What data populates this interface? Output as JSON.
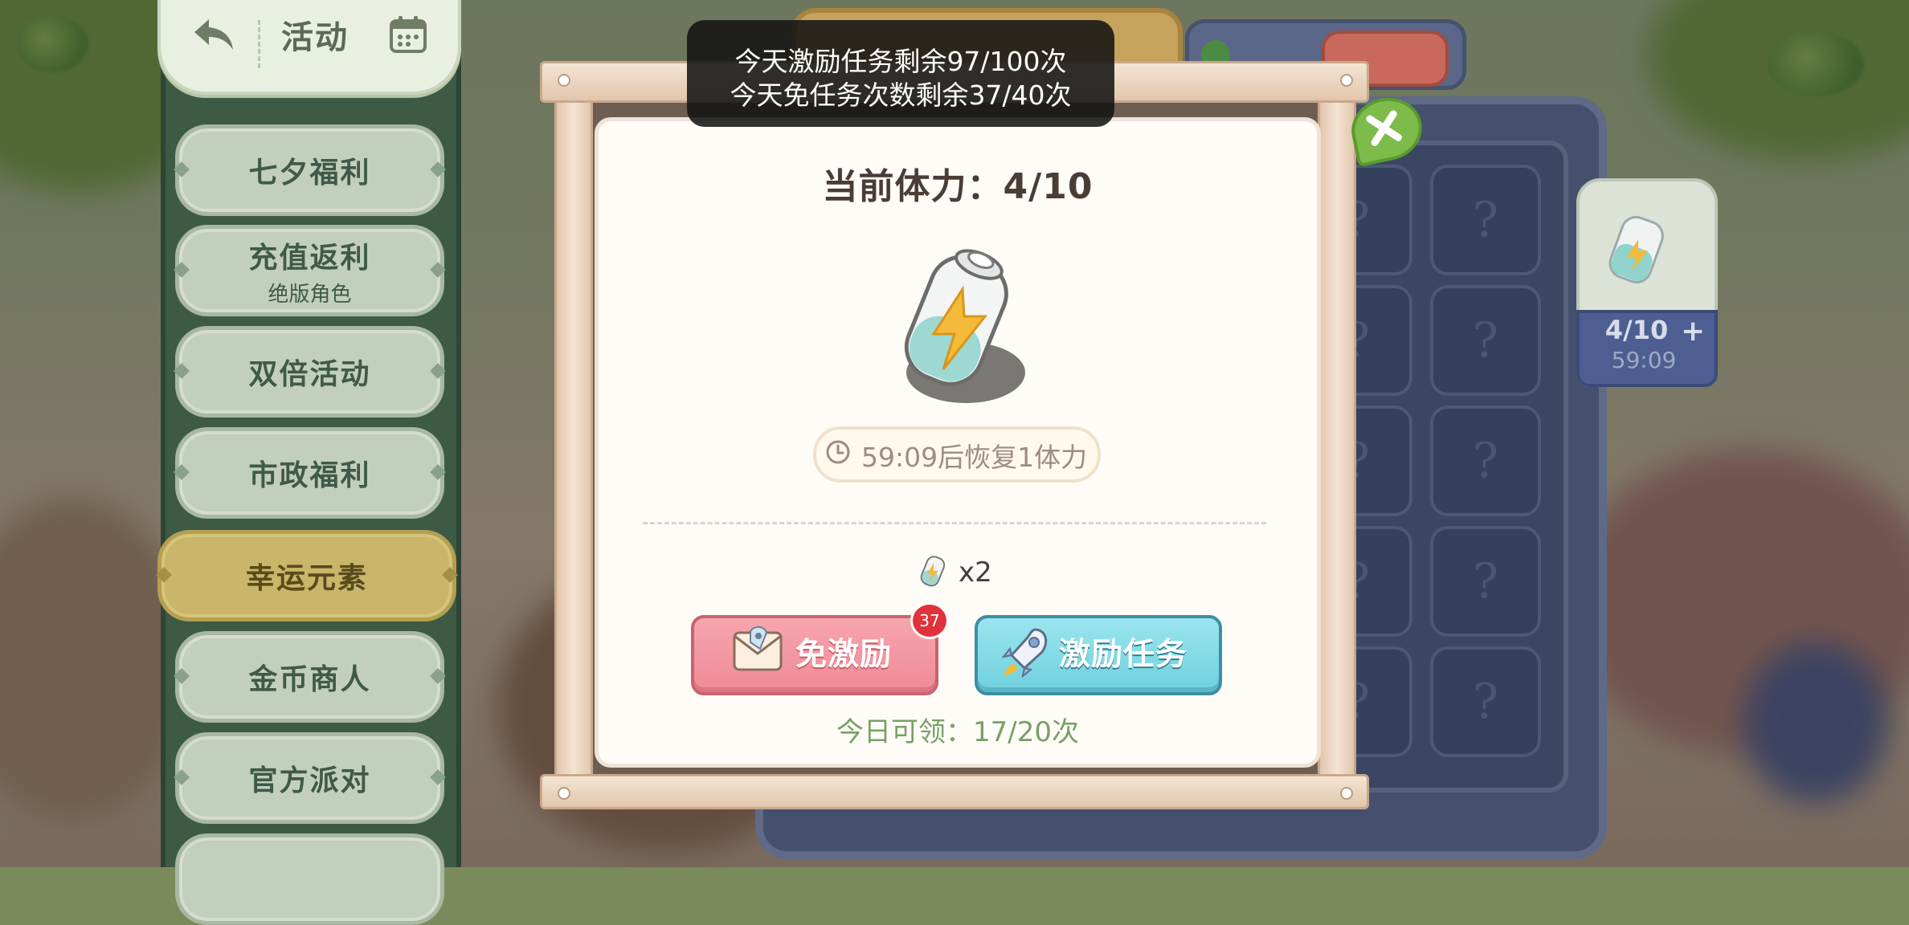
{
  "sidebar": {
    "title": "活动",
    "items": [
      {
        "label": "七夕福利",
        "sub": ""
      },
      {
        "label": "充值返利",
        "sub": "绝版角色"
      },
      {
        "label": "双倍活动",
        "sub": ""
      },
      {
        "label": "市政福利",
        "sub": ""
      },
      {
        "label": "幸运元素",
        "sub": "",
        "active": true
      },
      {
        "label": "金币商人",
        "sub": ""
      },
      {
        "label": "官方派对",
        "sub": ""
      }
    ]
  },
  "toast": {
    "line1": "今天激励任务剩余97/100次",
    "line2": "今天免任务次数剩余37/40次"
  },
  "modal": {
    "stamina_title": "当前体力：4/10",
    "recovery_text": "59:09后恢复1体力",
    "reward_count": "x2",
    "free_button": {
      "label": "免激励",
      "badge": "37"
    },
    "task_button": {
      "label": "激励任务"
    },
    "daily_claim": "今日可领：17/20次"
  },
  "stamina_tag": {
    "value": "4/10",
    "plus": "+",
    "timer": "59:09"
  },
  "colors": {
    "free_button": "#ef8b97",
    "task_button": "#6fd0dd",
    "daily_claim_text": "#79a065",
    "sidebar_active": "#c9b66b"
  },
  "icons": [
    "back-arrow-icon",
    "calendar-icon",
    "close-icon",
    "battery-icon",
    "clock-icon",
    "envelope-rocket-icon",
    "rocket-icon"
  ]
}
